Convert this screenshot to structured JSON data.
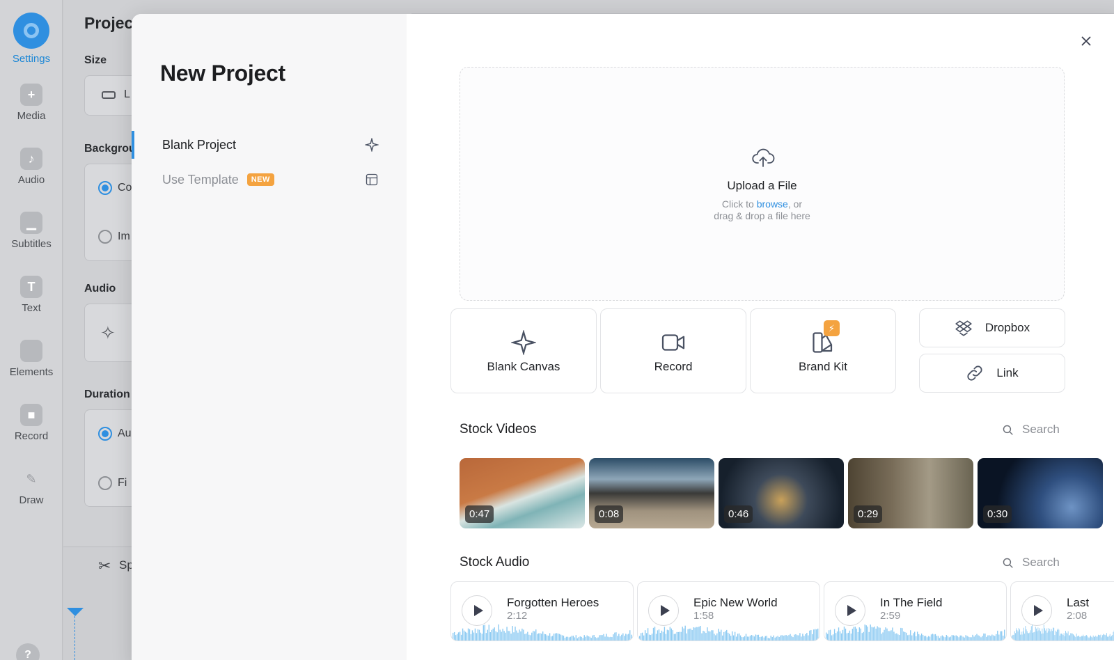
{
  "rail": {
    "items": [
      {
        "label": "Settings",
        "icon": "settings-icon",
        "active": true
      },
      {
        "label": "Media",
        "icon": "plus-icon"
      },
      {
        "label": "Audio",
        "icon": "music-note-icon"
      },
      {
        "label": "Subtitles",
        "icon": "subtitles-icon"
      },
      {
        "label": "Text",
        "icon": "text-icon"
      },
      {
        "label": "Elements",
        "icon": "elements-icon"
      },
      {
        "label": "Record",
        "icon": "camera-icon"
      },
      {
        "label": "Draw",
        "icon": "pencil-icon"
      }
    ],
    "help": "?"
  },
  "background_panel": {
    "title": "Project",
    "size_label": "Size",
    "size_value": "L",
    "background_label": "Background",
    "background_options": [
      "Co",
      "Im"
    ],
    "audio_label": "Audio",
    "duration_label": "Duration",
    "duration_options": [
      "Au",
      "Fi"
    ],
    "split_label": "Sp"
  },
  "modal": {
    "title": "New Project",
    "nav": [
      {
        "label": "Blank Project",
        "icon": "sparkle-icon",
        "active": true
      },
      {
        "label": "Use Template",
        "badge": "NEW",
        "icon": "template-icon"
      }
    ],
    "upload": {
      "title": "Upload a File",
      "line1_prefix": "Click to ",
      "line1_link": "browse",
      "line1_suffix": ", or",
      "line2": "drag & drop a file here"
    },
    "tiles": {
      "blank_canvas": "Blank Canvas",
      "record": "Record",
      "brand_kit": "Brand Kit",
      "dropbox": "Dropbox",
      "link": "Link"
    },
    "stock_videos": {
      "title": "Stock Videos",
      "search_placeholder": "Search",
      "items": [
        {
          "duration": "0:47"
        },
        {
          "duration": "0:08"
        },
        {
          "duration": "0:46"
        },
        {
          "duration": "0:29"
        },
        {
          "duration": "0:30"
        }
      ]
    },
    "stock_audio": {
      "title": "Stock Audio",
      "search_placeholder": "Search",
      "items": [
        {
          "title": "Forgotten Heroes",
          "duration": "2:12"
        },
        {
          "title": "Epic New World",
          "duration": "1:58"
        },
        {
          "title": "In The Field",
          "duration": "2:59"
        },
        {
          "title": "Last",
          "duration": "2:08"
        }
      ]
    }
  },
  "colors": {
    "accent": "#2f8fe0",
    "badge": "#f4a340"
  }
}
